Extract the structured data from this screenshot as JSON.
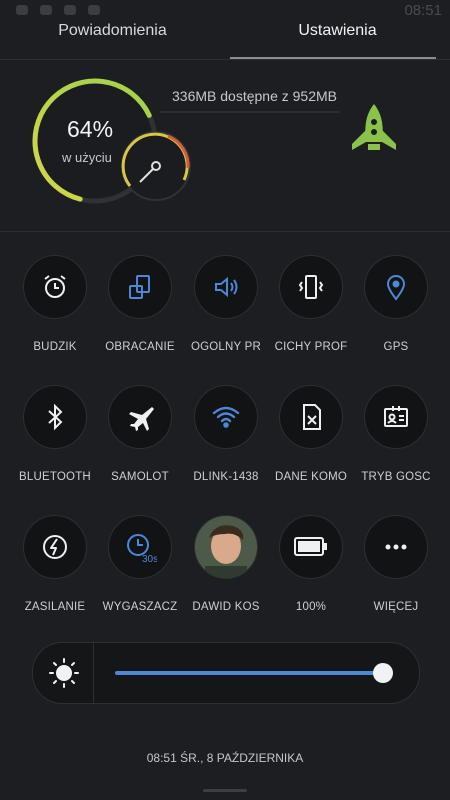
{
  "status_bar": {
    "time": "08:51"
  },
  "tabs": {
    "notifications": "Powiadomienia",
    "settings": "Ustawienia"
  },
  "memory": {
    "percent_text": "64%",
    "label": "w użyciu",
    "info": "336MB dostępne z 952MB",
    "used_fraction": 0.64
  },
  "toggles": [
    {
      "label": "BUDZIK",
      "icon": "alarm-clock-icon",
      "active": false
    },
    {
      "label": "OBRACANIE",
      "icon": "rotate-screen-icon",
      "active": true
    },
    {
      "label": "OGÓLNY PR",
      "icon": "volume-icon",
      "active": true
    },
    {
      "label": "CICHY PROF",
      "icon": "vibrate-icon",
      "active": false
    },
    {
      "label": "GPS",
      "icon": "location-pin-icon",
      "active": true
    },
    {
      "label": "BLUETOOTH",
      "icon": "bluetooth-icon",
      "active": false
    },
    {
      "label": "SAMOLOT",
      "icon": "airplane-icon",
      "active": false
    },
    {
      "label": "DLINK-1438",
      "icon": "wifi-icon",
      "active": true
    },
    {
      "label": "DANE KOMO",
      "icon": "sim-card-icon",
      "active": false
    },
    {
      "label": "TRYB GOŚC",
      "icon": "guest-badge-icon",
      "active": false
    },
    {
      "label": "ZASILANIE",
      "icon": "power-saving-icon",
      "active": false
    },
    {
      "label": "WYGASZACZ",
      "icon": "screen-timeout-icon",
      "active": true,
      "badge": "30s"
    },
    {
      "label": "DAWID KOS",
      "icon": "user-avatar",
      "active": false
    },
    {
      "label": "100%",
      "icon": "battery-icon",
      "active": false
    },
    {
      "label": "WIĘCEJ",
      "icon": "more-dots-icon",
      "active": false
    }
  ],
  "brightness": {
    "level": 0.97,
    "icon": "sun-icon"
  },
  "footer": {
    "datetime": "08:51  ŚR., 8 PAŹDZIERNIKA"
  },
  "colors": {
    "accent": "#4f87d8",
    "rocket": "#8bc34a",
    "background": "#1c1e21"
  }
}
